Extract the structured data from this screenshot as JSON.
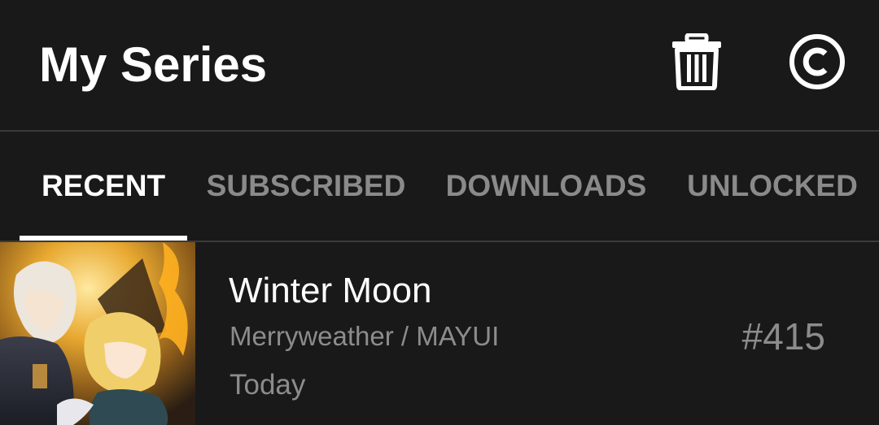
{
  "header": {
    "title": "My Series",
    "actions": [
      {
        "icon": "trash-icon"
      },
      {
        "icon": "coin-icon"
      }
    ]
  },
  "tabs": [
    {
      "label": "RECENT",
      "active": true
    },
    {
      "label": "SUBSCRIBED",
      "active": false
    },
    {
      "label": "DOWNLOADS",
      "active": false
    },
    {
      "label": "UNLOCKED",
      "active": false
    }
  ],
  "series_list": [
    {
      "title": "Winter Moon",
      "authors": "Merryweather / MAYUI",
      "last_read": "Today",
      "episode": "#415"
    }
  ],
  "colors": {
    "background": "#191919",
    "text_primary": "#ffffff",
    "text_secondary": "#8c8c8c",
    "divider": "#3a3a3a"
  }
}
